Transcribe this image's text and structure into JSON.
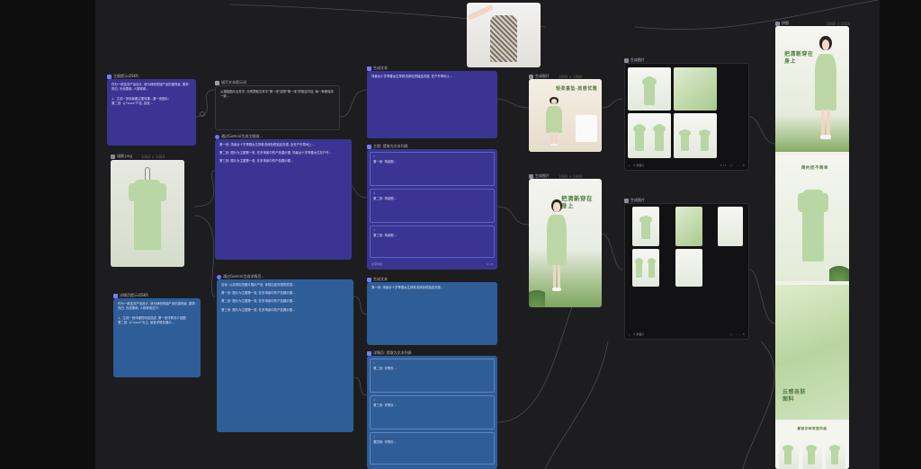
{
  "nodes": {
    "prompt1": {
      "title": "主图提示词SKR",
      "body": "作为一款连衣产品设计, 请为绿色短袖产品拍摄场景, 要求: 亮白, 光线柔和, 人物穿着...\n\n1、生成一张场景图主图效果...第一张图片:\n第二张: 以\"xxxx\"产品, 适宜..."
    },
    "product": {
      "title": "裙裤.png",
      "meta": "1080 × 1080"
    },
    "prompt2": {
      "title": "详情页提示词SKR",
      "body": "作为一款连衣产品设计, 请为绿色短袖产品拍摄场景, 要求: 亮白, 光线柔和, 人物穿着如下:\n\n1、生成一张详细的商品描述, 第一张详情页介绍图\n第二张: 以\"xxxx\"为主, 适宜详情页展示..."
    },
    "textPrompt": {
      "title": "描写文本提示词",
      "body": "从裙装图片出发中, 分别提取文本中\"第一张\"或是\"第一张\"的相应内容, 每一条都保持一致..."
    },
    "gemini1": {
      "title": "通过Gemini生成主图描...",
      "paras": [
        "第一张: 场景台十岁青春女生穿着浅绿色短袖连衣裙, 坐在户外草地上...",
        "第二张: 图片为主图第一张, 在多场景中的产品展示图, 场景台十岁青春女生在户外...",
        "第三张: 图片为主图第一张, 在多场景中的产品展示图..."
      ]
    },
    "gemini2": {
      "title": "通过Gemini生成详情页...",
      "paras": [
        "目标: 以高清实拍图片展示产品, 体现出连衣裙的质感...",
        "第一张: 图片为主图第一张, 在多场景中的产品展示图...",
        "第二张: 图片为主图第一张, 在多场景中的产品展示图...",
        "第三张: 图片为主图第一张, 在多场景中的产品展示图..."
      ]
    },
    "genText1": {
      "title": "生成文本",
      "body": "场景台十岁青春女生穿着浅绿色短袖连衣裙, 在户外草地上..."
    },
    "split1": {
      "title": "主图: 提取为文本列表",
      "items": [
        "第一张: 场景图...",
        "第二张: 场景图...",
        "第三张: 场景图..."
      ],
      "footer_left": "文字列表",
      "footer_right": "1 / 3"
    },
    "genText2": {
      "title": "生成文本",
      "body": "第一张: 场景台十岁青春女生穿着浅绿色短袖连衣裙..."
    },
    "split2": {
      "title": "详情页: 提取为文本列表",
      "items": [
        "第二张: 详情页...",
        "第三张: 详情页...",
        "第四张: 详情页..."
      ]
    },
    "genImg1": {
      "title": "生成图片",
      "meta": "1080 × 1080",
      "caption": "轻柔垂坠·质感优雅"
    },
    "genImg2": {
      "title": "生成图片",
      "meta": "1080 × 1440",
      "caption": "把清新穿在身上"
    },
    "genImgs1": {
      "title": "生成图片",
      "footer_left": "5 张图片",
      "footer_pager": "1 / 1"
    },
    "genImgs2": {
      "title": "生成图片",
      "footer_left": "5 张图片"
    },
    "detailPage": {
      "title": "拼图",
      "meta": "1080 × 6500",
      "heading1": "把清新穿在身上",
      "heading2": "简约而不简单",
      "heading3": "云感亲肤面料",
      "heading4": "解锁多种穿搭风格"
    }
  },
  "colors": {
    "canvas": "#1d1d20",
    "purple_node": "#3a3592",
    "blue_node": "#2f5d97",
    "dark_node": "#202024",
    "dress_green": "#b8d7a4"
  }
}
